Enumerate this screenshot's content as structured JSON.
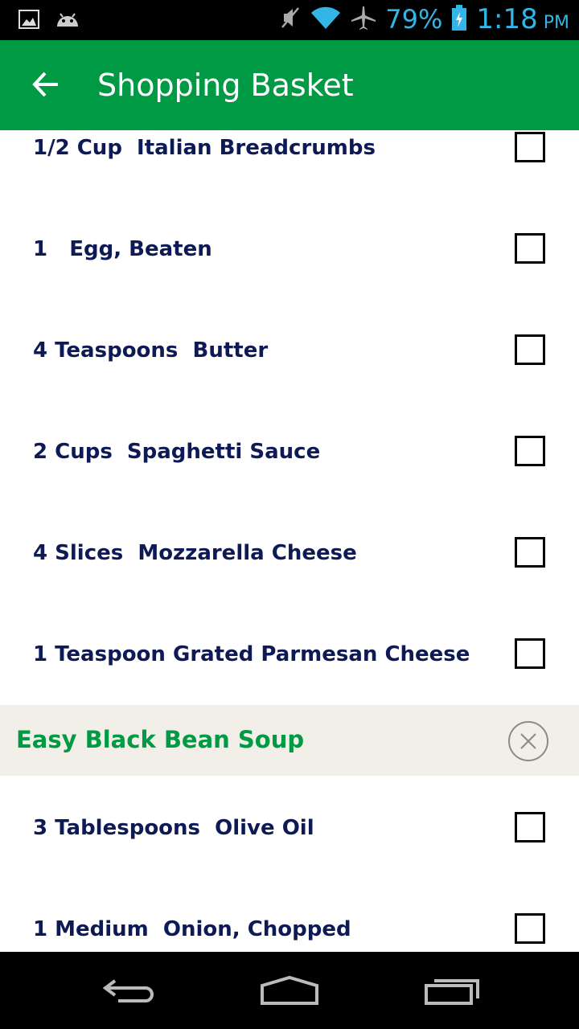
{
  "status": {
    "battery": "79%",
    "time": "1:18",
    "ampm": "PM"
  },
  "toolbar": {
    "title": "Shopping Basket"
  },
  "list": [
    {
      "type": "item",
      "label": "1/2 Cup  Italian Breadcrumbs",
      "checked": false
    },
    {
      "type": "item",
      "label": "1   Egg, Beaten",
      "checked": false
    },
    {
      "type": "item",
      "label": "4 Teaspoons  Butter",
      "checked": false
    },
    {
      "type": "item",
      "label": "2 Cups  Spaghetti Sauce",
      "checked": false
    },
    {
      "type": "item",
      "label": "4 Slices  Mozzarella Cheese",
      "checked": false
    },
    {
      "type": "item",
      "label": "1 Teaspoon Grated Parmesan Cheese",
      "checked": false
    },
    {
      "type": "section",
      "label": "Easy Black Bean Soup"
    },
    {
      "type": "item",
      "label": "3 Tablespoons  Olive Oil",
      "checked": false
    },
    {
      "type": "item",
      "label": "1 Medium  Onion, Chopped",
      "checked": false
    }
  ],
  "colors": {
    "accent": "#009a44",
    "text": "#0d1a55",
    "section_bg": "#f1efe8",
    "status": "#33b5e5"
  }
}
